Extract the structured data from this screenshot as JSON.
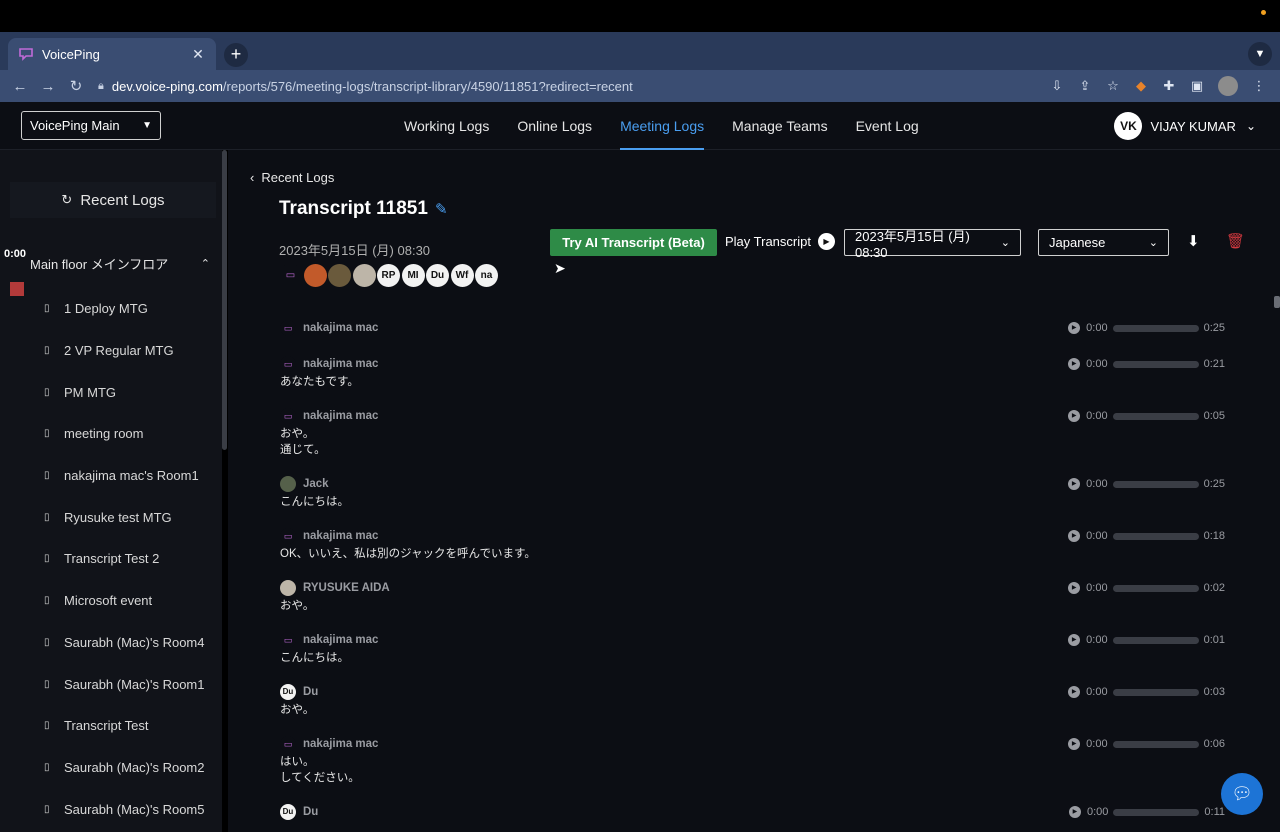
{
  "browser": {
    "tab_title": "VoicePing",
    "new_tab_glyph": "+",
    "url_host": "dev.voice-ping.com",
    "url_path": "/reports/576/meeting-logs/transcript-library/4590/11851?redirect=recent"
  },
  "header": {
    "workspace": "VoicePing Main",
    "nav": [
      "Working Logs",
      "Online Logs",
      "Meeting Logs",
      "Manage Teams",
      "Event Log"
    ],
    "active_nav": "Meeting Logs",
    "user_initials": "VK",
    "user_name": "VIJAY KUMAR"
  },
  "sidebar": {
    "recent_logs": "Recent Logs",
    "timer": "0:00",
    "floor": "Main floor メインフロア",
    "rooms": [
      "1 Deploy MTG",
      "2 VP Regular MTG",
      "PM MTG",
      "meeting room",
      "nakajima mac's Room1",
      "Ryusuke test MTG",
      "Transcript Test 2",
      "Microsoft event",
      "Saurabh (Mac)'s Room4",
      "Saurabh (Mac)'s Room1",
      "Transcript Test",
      "Saurabh (Mac)'s Room2",
      "Saurabh (Mac)'s Room5"
    ]
  },
  "main": {
    "back_label": "Recent Logs",
    "title": "Transcript 11851",
    "date": "2023年5月15日 (月) 08:30",
    "participants": [
      "RP",
      "MI",
      "Du",
      "Wf",
      "na"
    ],
    "ai_button": "Try AI Transcript (Beta)",
    "play_transcript": "Play Transcript",
    "date_select": "2023年5月15日 (月) 08:30",
    "language": "Japanese",
    "entries": [
      {
        "speaker": "nakajima mac",
        "start": "0:00",
        "end": "0:25",
        "lines": []
      },
      {
        "speaker": "nakajima mac",
        "start": "0:00",
        "end": "0:21",
        "lines": [
          "あなたもです。"
        ]
      },
      {
        "speaker": "nakajima mac",
        "start": "0:00",
        "end": "0:05",
        "lines": [
          "おや。",
          "通じて。"
        ]
      },
      {
        "speaker": "Jack",
        "start": "0:00",
        "end": "0:25",
        "lines": [
          "こんにちは。"
        ]
      },
      {
        "speaker": "nakajima mac",
        "start": "0:00",
        "end": "0:18",
        "lines": [
          "OK、いいえ、私は別のジャックを呼んでいます。"
        ]
      },
      {
        "speaker": "RYUSUKE AIDA",
        "start": "0:00",
        "end": "0:02",
        "lines": [
          "おや。"
        ]
      },
      {
        "speaker": "nakajima mac",
        "start": "0:00",
        "end": "0:01",
        "lines": [
          "こんにちは。"
        ]
      },
      {
        "speaker": "Du",
        "start": "0:00",
        "end": "0:03",
        "lines": [
          "おや。"
        ]
      },
      {
        "speaker": "nakajima mac",
        "start": "0:00",
        "end": "0:06",
        "lines": [
          "はい。",
          "してください。"
        ]
      },
      {
        "speaker": "Du",
        "start": "0:00",
        "end": "0:11",
        "lines": []
      }
    ]
  },
  "icons": {
    "logo": "voiceping-logo-icon",
    "edit": "pencil-icon",
    "download": "download-icon",
    "delete": "trash-icon",
    "chat": "chat-bubble-icon"
  },
  "colors": {
    "accent": "#4a9ef0",
    "ai_button": "#2e8b47",
    "delete": "#d0383e",
    "chat_fab": "#1d74d6"
  }
}
